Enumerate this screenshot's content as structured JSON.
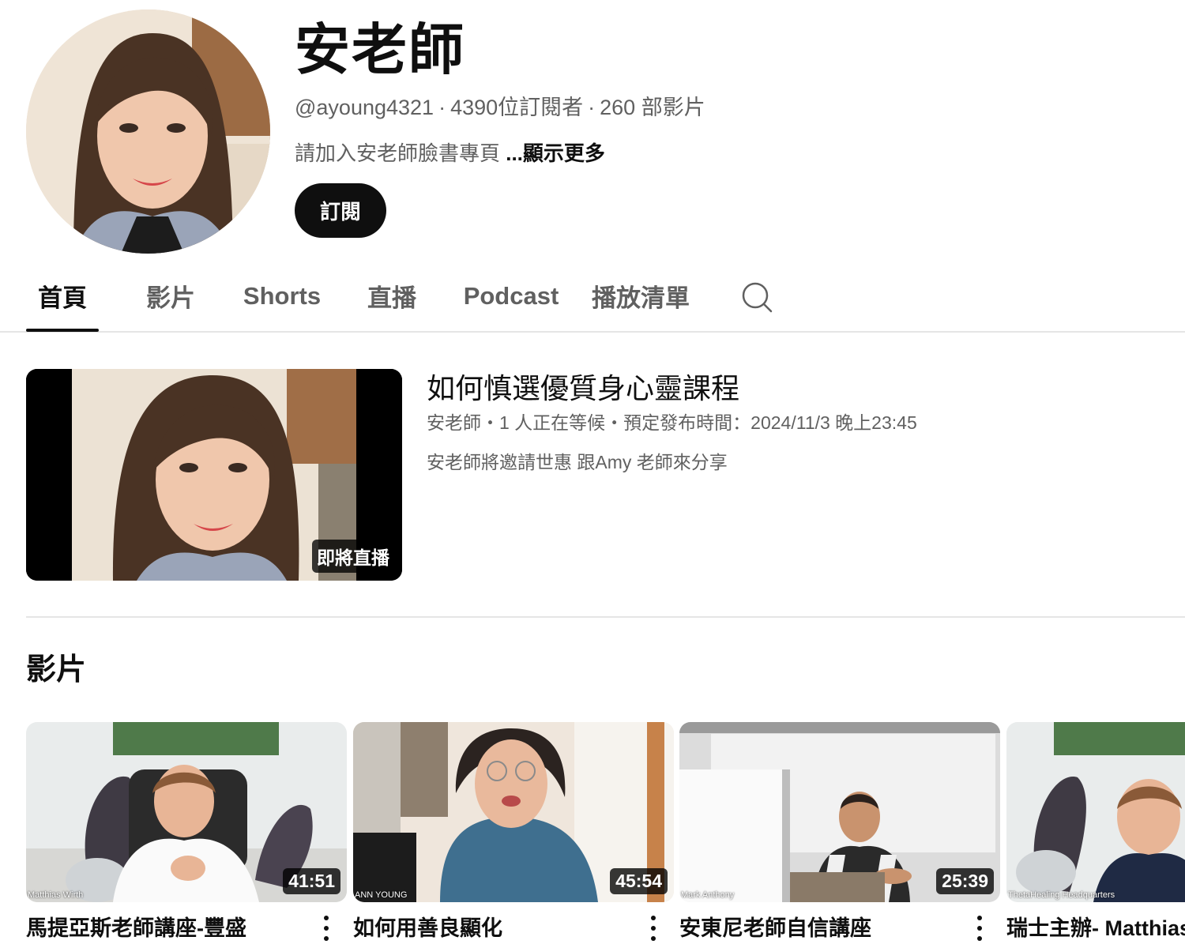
{
  "channel": {
    "name": "安老師",
    "handle": "@ayoung4321",
    "separator": "·",
    "subscribers": "4390位訂閱者",
    "video_count": "260 部影片",
    "description": "請加入安老師臉書專頁 ",
    "show_more": "...顯示更多",
    "subscribe_label": "訂閱"
  },
  "tabs": [
    {
      "label": "首頁",
      "active": true
    },
    {
      "label": "影片"
    },
    {
      "label": "Shorts"
    },
    {
      "label": "直播"
    },
    {
      "label": "Podcast"
    },
    {
      "label": "播放清單"
    }
  ],
  "featured": {
    "title": "如何慎選優質身心靈課程",
    "meta": "安老師・1 人正在等候・預定發布時間：2024/11/3 晚上23:45",
    "description": "安老師將邀請世惠 跟Amy 老師來分享",
    "badge": "即將直播"
  },
  "videos_shelf": {
    "title": "影片",
    "items": [
      {
        "title": "馬提亞斯老師講座-豐盛",
        "duration": "41:51",
        "watermark": "Matthias Wirth"
      },
      {
        "title": "如何用善良顯化",
        "duration": "45:54",
        "watermark": "ANN YOUNG"
      },
      {
        "title": "安東尼老師自信講座",
        "duration": "25:39",
        "watermark": "Mark Anthony"
      },
      {
        "title": "瑞士主辦- Matthias",
        "duration": "",
        "watermark": "ThetaHealing Headquarters"
      }
    ]
  },
  "icons": {
    "search": "search-icon",
    "more": "more-vert-icon"
  }
}
